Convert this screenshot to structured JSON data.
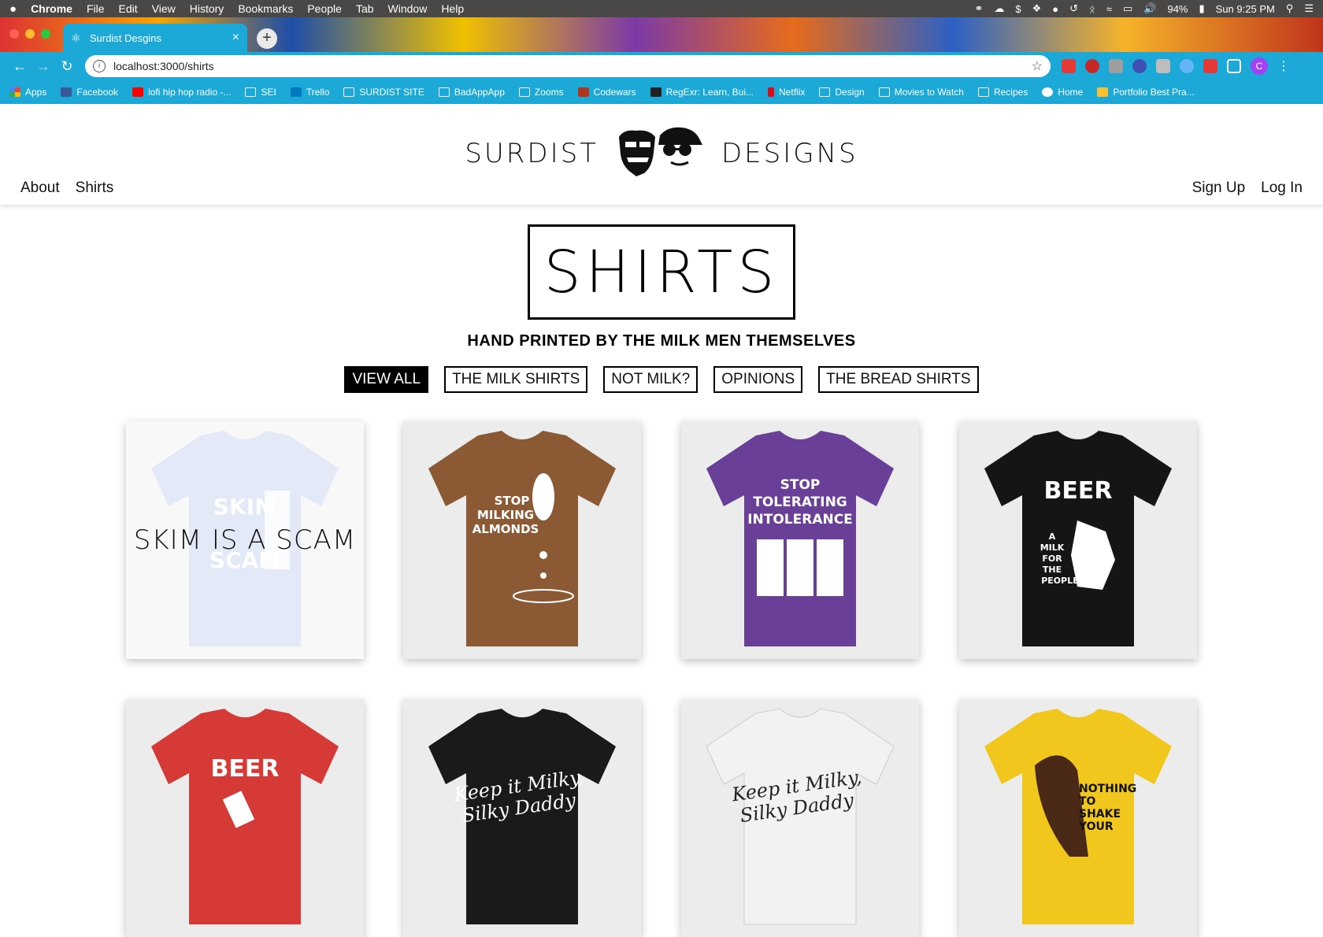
{
  "menubar": {
    "items": [
      "Chrome",
      "File",
      "Edit",
      "View",
      "History",
      "Bookmarks",
      "People",
      "Tab",
      "Window",
      "Help"
    ],
    "battery": "94%",
    "clock": "Sun 9:25 PM"
  },
  "browser": {
    "tab_title": "Surdist Desgins",
    "url": "localhost:3000/shirts",
    "bookmarks": [
      "Apps",
      "Facebook",
      "lofi hip hop radio -...",
      "SEI",
      "Trello",
      "SURDIST SITE",
      "BadAppApp",
      "Zooms",
      "Codewars",
      "RegExr: Learn, Bui...",
      "Netflix",
      "Design",
      "Movies to Watch",
      "Recipes",
      "Home",
      "Portfolio Best Pra..."
    ],
    "profile_initial": "C"
  },
  "site": {
    "logo_left": "SURDIST",
    "logo_right": "DESIGNS",
    "nav_left": [
      "About",
      "Shirts"
    ],
    "nav_right": [
      "Sign Up",
      "Log In"
    ]
  },
  "page": {
    "title": "SHIRTS",
    "subtitle": "HAND PRINTED BY THE MILK MEN THEMSELVES",
    "filters": [
      "VIEW ALL",
      "THE MILK SHIRTS",
      "NOT MILK?",
      "OPINIONS",
      "THE BREAD SHIRTS"
    ],
    "active_filter": "VIEW ALL"
  },
  "products": [
    {
      "shirt_color": "#cdd7ef",
      "hover_label": "SKIM IS A SCAM",
      "print_lines": [
        "SKIM",
        "SCAM"
      ]
    },
    {
      "shirt_color": "#8b5a34",
      "print_lines": [
        "STOP",
        "MILKING",
        "ALMONDS"
      ]
    },
    {
      "shirt_color": "#6a3f98",
      "print_lines": [
        "STOP",
        "TOLERATING",
        "INTOLERANCE"
      ]
    },
    {
      "shirt_color": "#151515",
      "print_lines": [
        "BEER",
        "A",
        "MILK",
        "FOR",
        "THE",
        "PEOPLE"
      ]
    },
    {
      "shirt_color": "#d63a36",
      "print_lines": [
        "BEER"
      ]
    },
    {
      "shirt_color": "#1a1a1a",
      "print_lines": [
        "Keep it Milky,",
        "Silky Daddy"
      ]
    },
    {
      "shirt_color": "#f2f2f2",
      "print_lines": [
        "Keep it Milky,",
        "Silky Daddy"
      ]
    },
    {
      "shirt_color": "#f2c71d",
      "print_lines": [
        "NOTHING",
        "TO",
        "SHAKE",
        "YOUR"
      ]
    }
  ]
}
